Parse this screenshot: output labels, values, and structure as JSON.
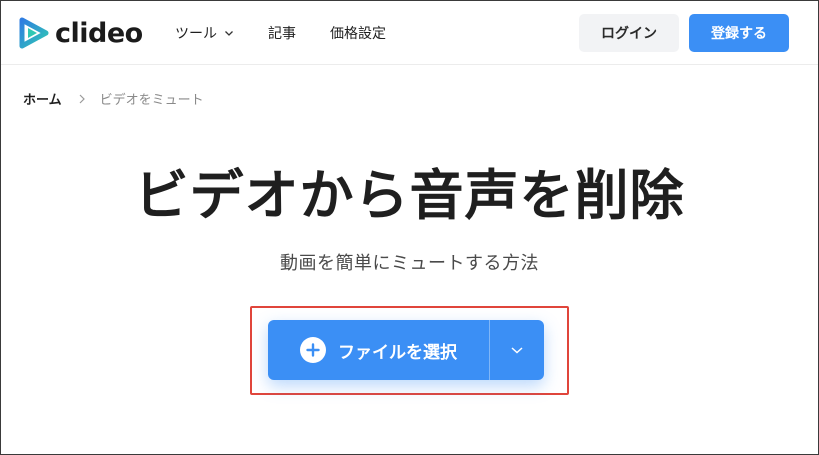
{
  "header": {
    "logo_text": "clideo",
    "nav": [
      {
        "label": "ツール",
        "has_dropdown": true
      },
      {
        "label": "記事"
      },
      {
        "label": "価格設定"
      }
    ],
    "login_label": "ログイン",
    "signup_label": "登録する"
  },
  "breadcrumb": {
    "home": "ホーム",
    "current": "ビデオをミュート"
  },
  "hero": {
    "title": "ビデオから音声を削除",
    "subtitle": "動画を簡単にミュートする方法",
    "upload_label": "ファイルを選択"
  },
  "colors": {
    "accent": "#3b8ff5",
    "highlight": "#e0453b",
    "logo_blue": "#2f7de1",
    "logo_teal": "#30c8b4"
  },
  "icons": {
    "logo": "clideo-play-logo-icon",
    "nav_chevron": "chevron-down-icon",
    "breadcrumb_sep": "chevron-right-icon",
    "upload_plus": "plus-icon",
    "upload_dropdown": "chevron-down-icon"
  }
}
